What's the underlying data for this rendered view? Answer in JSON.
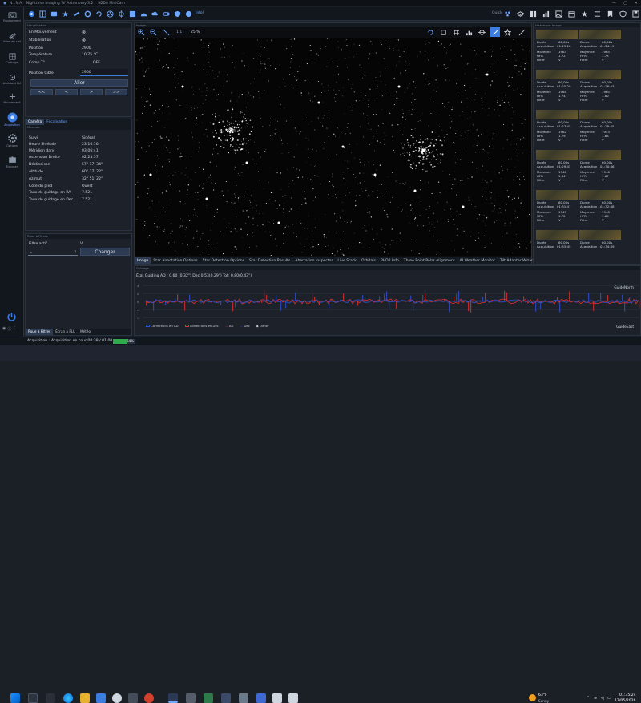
{
  "titlebar": {
    "app_short": "N.I.N.A.",
    "title": "Nighttime Imaging 'N' Astronomy 3.2",
    "camera": "N2D0 MiniCam"
  },
  "toolbar": {
    "profile_label": "InfoI",
    "quick_label": "Quick"
  },
  "left_nav": {
    "items": [
      {
        "label": "Équipement",
        "icon": "camera-icon"
      },
      {
        "label": "Atlas du ciel",
        "icon": "telescope-icon"
      },
      {
        "label": "Cadrage",
        "icon": "framing-icon"
      },
      {
        "label": "Assistant FLI",
        "icon": "focus-icon"
      },
      {
        "label": "Mouvement",
        "icon": "move-icon"
      },
      {
        "label": "Acquisition",
        "icon": "acquisition-icon"
      },
      {
        "label": "Options",
        "icon": "gear-icon"
      },
      {
        "label": "Exposer",
        "icon": "puzzle-icon"
      }
    ]
  },
  "visualisation_panel": {
    "title": "Visualisation",
    "rows": [
      {
        "label": "En Mouvement",
        "value": "⊗"
      },
      {
        "label": "Stabilisation",
        "value": "⊗"
      },
      {
        "label": "Position",
        "value": "2900"
      },
      {
        "label": "Température",
        "value": "10.75 °C"
      },
      {
        "label": "Comp T°",
        "value": "OFF"
      },
      {
        "label": "Position Cible",
        "value": "2900"
      }
    ],
    "go_button": "Aller",
    "steps": [
      "<<",
      "<",
      ">",
      ">>"
    ]
  },
  "camera_panel": {
    "tabs": [
      "Caméra",
      "Focalisation"
    ],
    "subtitle": "Monture",
    "rows": [
      {
        "label": "Suivi",
        "value": "Sidéral"
      },
      {
        "label": "Heure Sidérale",
        "value": "23:16:16"
      },
      {
        "label": "Méridien dans",
        "value": "03:06:41"
      },
      {
        "label": "Ascension Droite",
        "value": "02:23:57"
      },
      {
        "label": "Déclinaison",
        "value": "57° 17' 34\""
      },
      {
        "label": "Altitude",
        "value": "60° 27' 22\""
      },
      {
        "label": "Azimut",
        "value": "32° 51' 22\""
      },
      {
        "label": "Côté du pied",
        "value": "Ouest"
      },
      {
        "label": "Taux de guidage en RA",
        "value": "7.521"
      },
      {
        "label": "Taux de guidage en Dec",
        "value": "7.521"
      }
    ]
  },
  "filter_panel": {
    "title": "Roue à Filtres",
    "label": "Filtre actif",
    "value": "V",
    "select_value": "L",
    "change_button": "Changer",
    "bottom_tabs": [
      "Roue à Filtres",
      "Écran à PLU",
      "Météo"
    ]
  },
  "image_panel": {
    "title": "Image",
    "zoom": "25 %",
    "fit_label": "1:1",
    "bottom_tabs": [
      "Image",
      "Star Annotation Options",
      "Star Detection Options",
      "Star Detection Results",
      "Aberration Inspector",
      "Live Stack",
      "Orbitals",
      "PHD2 Info",
      "Three Point Polar Alignment",
      "AI Weather Monitor",
      "Tilt Adapter Wizard"
    ]
  },
  "history_panel": {
    "title": "Historique Image",
    "entries": [
      {
        "duree": "60,00s",
        "acq": "01:23:18",
        "moy": "1963",
        "hfr": "1.72",
        "filtre": "V"
      },
      {
        "duree": "60,00s",
        "acq": "01:24:19",
        "moy": "1965",
        "hfr": "1.73",
        "filtre": "V"
      },
      {
        "duree": "60,00s",
        "acq": "01:25:20",
        "moy": "1964",
        "hfr": "1.74",
        "filtre": "V"
      },
      {
        "duree": "60,00s",
        "acq": "01:26:43",
        "moy": "1965",
        "hfr": "1.80",
        "filtre": "V"
      },
      {
        "duree": "60,00s",
        "acq": "01:27:45",
        "moy": "1962",
        "hfr": "1.79",
        "filtre": "V"
      },
      {
        "duree": "60,00s",
        "acq": "01:28:45",
        "moy": "1953",
        "hfr": "1.68",
        "filtre": "V"
      },
      {
        "duree": "60,00s",
        "acq": "01:29:45",
        "moy": "1946",
        "hfr": "1.64",
        "filtre": "V"
      },
      {
        "duree": "60,00s",
        "acq": "01:30:46",
        "moy": "1946",
        "hfr": "1.67",
        "filtre": "V"
      },
      {
        "duree": "60,00s",
        "acq": "01:31:47",
        "moy": "1947",
        "hfr": "1.72",
        "filtre": "V"
      },
      {
        "duree": "60,00s",
        "acq": "01:32:48",
        "moy": "1948",
        "hfr": "1.68",
        "filtre": "V"
      },
      {
        "duree": "60,00s",
        "acq": "01:33:49",
        "moy": "",
        "hfr": "",
        "filtre": ""
      },
      {
        "duree": "60,00s",
        "acq": "01:34:49",
        "moy": "",
        "hfr": "",
        "filtre": ""
      }
    ],
    "labels": {
      "duree": "Durée",
      "acq": "Acquisition",
      "moy": "Moyenne",
      "hfr": "HFR",
      "filtre": "Filtre"
    }
  },
  "guiding_panel": {
    "title": "Guidage",
    "status": "État Guiding AD : 0.60 (0.32\") Dec 0.53(0.29\") Tot: 0.80(0.43\")",
    "north": "GuideNorth",
    "east": "GuideEast",
    "legend": [
      "Corrections en AD",
      "Corrections en Dec",
      "AD",
      "Dec",
      "Dither"
    ],
    "colors": {
      "ra": "#e03030",
      "dec": "#3050d0"
    }
  },
  "status_bar": {
    "label": "Acquisition :",
    "text": "Acquisition en cour 00:38 / 01:00",
    "progress_percent": "64%",
    "progress": 0.64
  },
  "taskbar": {
    "temperature": "63°F",
    "weather": "Sunny",
    "time": "01:35:24",
    "date": "17/05/2026"
  }
}
